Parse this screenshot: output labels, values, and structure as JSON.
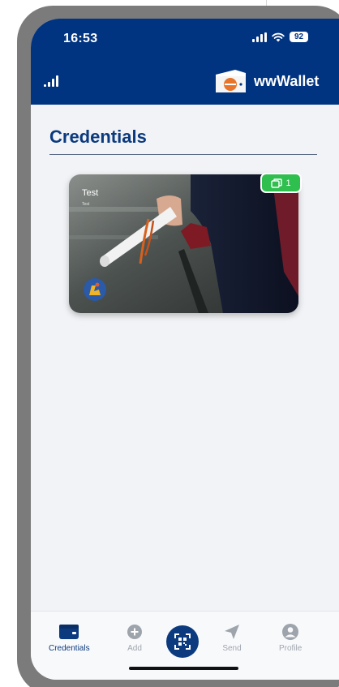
{
  "status_bar": {
    "time": "16:53",
    "battery": "92",
    "icons": [
      "cellular-signal-icon",
      "wifi-icon",
      "battery-icon"
    ]
  },
  "app_header": {
    "brand_name": "wwWallet",
    "icons": [
      "signal-bars-icon",
      "wallet-logo-icon"
    ],
    "background_color": "#003380"
  },
  "page": {
    "title": "Credentials"
  },
  "credential_card": {
    "title": "Test",
    "subtitle": "Test",
    "count": "1",
    "icons": [
      "copy-icon",
      "issuer-logo-icon"
    ],
    "badge_color": "#2fbf4f"
  },
  "bottom_nav": {
    "items": [
      {
        "label": "Credentials",
        "icon": "wallet-icon",
        "active": true
      },
      {
        "label": "Add",
        "icon": "plus-circle-icon",
        "active": false
      },
      {
        "label": "",
        "icon": "qr-scan-icon",
        "active": false
      },
      {
        "label": "Send",
        "icon": "send-icon",
        "active": false
      },
      {
        "label": "Profile",
        "icon": "profile-icon",
        "active": false
      }
    ],
    "active_color": "#0b3a7e"
  }
}
